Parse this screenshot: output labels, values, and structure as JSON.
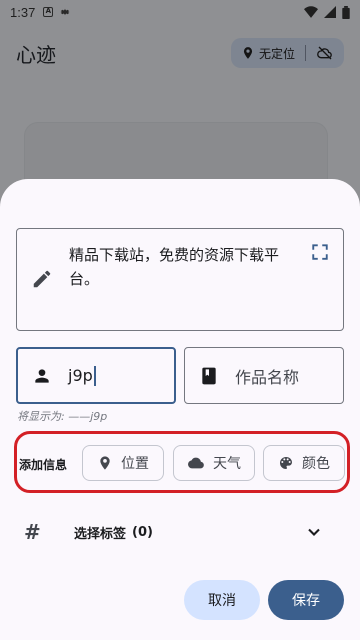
{
  "status_bar": {
    "time": "1:37",
    "left_icons": [
      "notification-a-icon",
      "settings-gear-icon"
    ],
    "right_icons": [
      "wifi-icon",
      "signal-icon",
      "battery-icon"
    ]
  },
  "app": {
    "title": "心迹",
    "location_chip": {
      "label": "无定位",
      "icon": "location-pin-icon",
      "cloud_icon": "cloud-off-icon"
    }
  },
  "sheet": {
    "content": {
      "text": "精品下载站，免费的资源下载平台。",
      "icon": "edit-icon",
      "action_icon": "fullscreen-icon"
    },
    "author": {
      "value": "j9p",
      "icon": "person-icon"
    },
    "work": {
      "placeholder": "作品名称",
      "icon": "book-icon"
    },
    "preview_hint": "将显示为: ——j9p",
    "add_info": {
      "label": "添加信息",
      "chips": [
        {
          "label": "位置",
          "icon": "location-pin-icon"
        },
        {
          "label": "天气",
          "icon": "cloud-icon"
        },
        {
          "label": "颜色",
          "icon": "palette-icon"
        }
      ]
    },
    "tags": {
      "label": "选择标签",
      "count": "(0)"
    },
    "buttons": {
      "cancel": "取消",
      "save": "保存"
    }
  },
  "colors": {
    "primary": "#3b5f8d",
    "cancel_bg": "#d4e3ff",
    "highlight_border": "#d32026",
    "sheet_bg": "#fbf8fd",
    "scrim": "#8f9093"
  }
}
